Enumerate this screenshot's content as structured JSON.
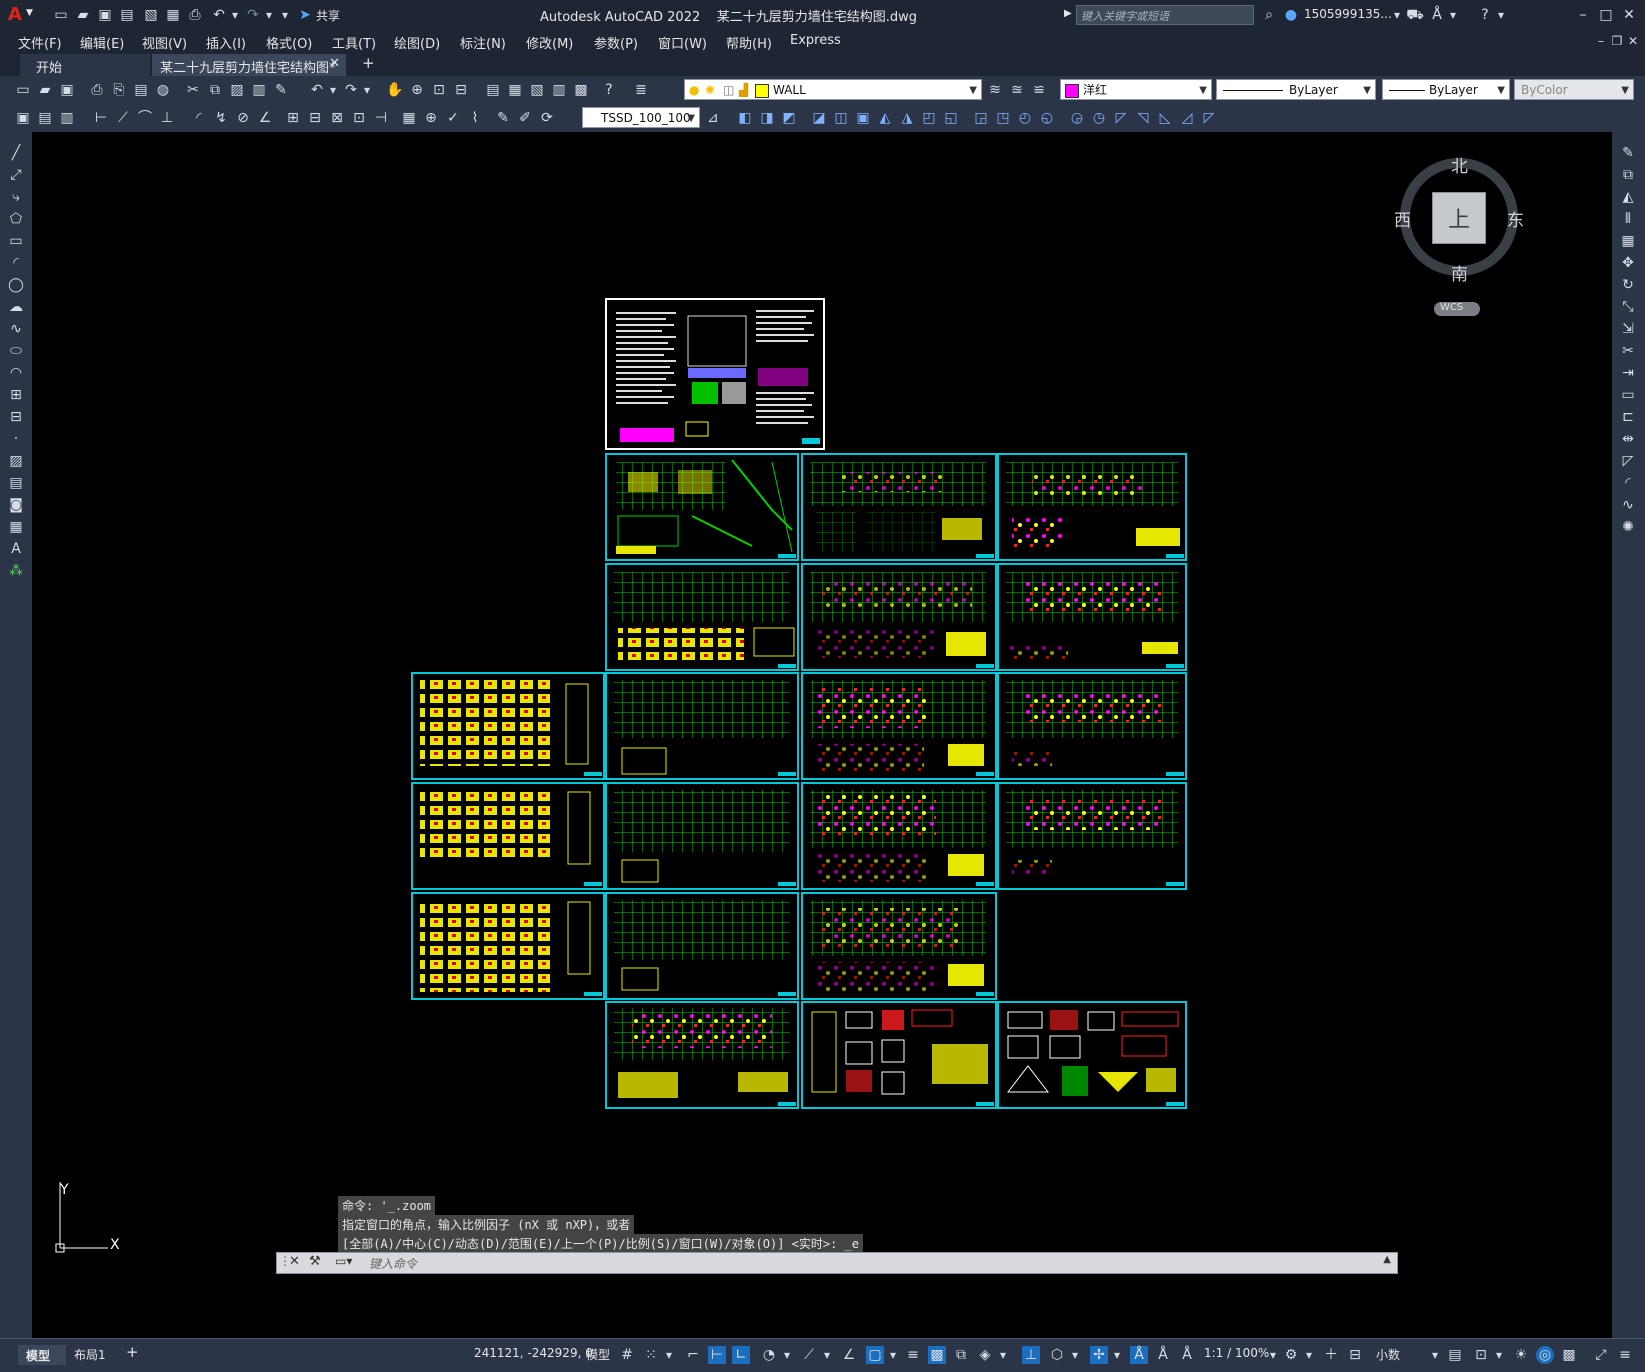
{
  "app": {
    "title": "Autodesk AutoCAD 2022    某二十九层剪力墙住宅结构图.dwg",
    "share_label": "共享",
    "search_placeholder": "键入关键字或短语",
    "user": "1505999135..."
  },
  "menu": {
    "items": [
      "文件(F)",
      "编辑(E)",
      "视图(V)",
      "插入(I)",
      "格式(O)",
      "工具(T)",
      "绘图(D)",
      "标注(N)",
      "修改(M)",
      "参数(P)",
      "窗口(W)",
      "帮助(H)",
      "Express"
    ]
  },
  "tabs": {
    "start": "开始",
    "doc": "某二十九层剪力墙住宅结构图*",
    "add": "+"
  },
  "toolbar": {
    "layer_name": "WALL",
    "color_name": "洋红",
    "linetype": "ByLayer",
    "lineweight": "ByLayer",
    "plotstyle": "ByColor",
    "dimstyle": "TSSD_100_100"
  },
  "viewcube": {
    "north": "北",
    "south": "南",
    "east": "东",
    "west": "西",
    "face": "上",
    "wcs": "WCS"
  },
  "ucs": {
    "x": "X",
    "y": "Y"
  },
  "command": {
    "history": [
      "命令: '_.zoom",
      "指定窗口的角点，输入比例因子 (nX 或 nXP)，或者",
      "[全部(A)/中心(C)/动态(D)/范围(E)/上一个(P)/比例(S)/窗口(W)/对象(O)] <实时>: _e"
    ],
    "placeholder": "键入命令"
  },
  "status": {
    "model_tab": "模型",
    "layout_tab": "布局1",
    "add": "+",
    "coords": "241121, -242929, 0",
    "space": "模型",
    "scale": "1:1 / 100%",
    "units": "小数"
  },
  "colors": {
    "sheet_border": "#00c8d8",
    "accent_magenta": "#ff00ff",
    "layer_yellow": "#ffff00"
  }
}
